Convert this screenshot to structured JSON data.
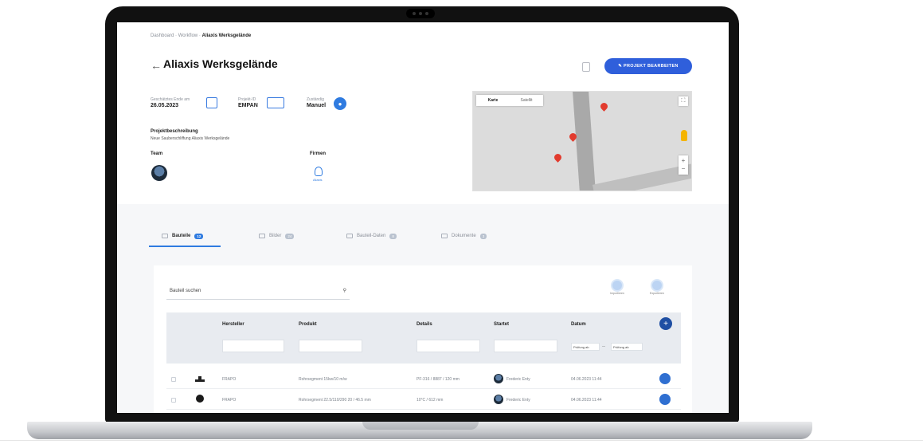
{
  "breadcrumb": {
    "item1": "Dashboard",
    "item2": "Workflow",
    "current": "Aliaxis Werksgelände"
  },
  "header": {
    "back_icon": "back-arrow-icon",
    "title": "Aliaxis Werksgelände",
    "edit_label": "✎ PROJEKT BEARBEITEN"
  },
  "meta": {
    "date_label": "Geschätztes Ende am",
    "date_value": "26.05.2023",
    "code_label": "Projekt-ID",
    "code_value": "EMPAN",
    "status_label": "Zuständig",
    "status_value": "Manuel"
  },
  "description": {
    "heading": "Projektbeschreibung",
    "text": "Neue Sauberschliffung Aliaxis Werksgelände"
  },
  "team": {
    "heading": "Team"
  },
  "firms": {
    "heading": "Firmen",
    "item_label": "Aliaxis"
  },
  "map": {
    "tab_map": "Karte",
    "tab_satellite": "Satellit",
    "pin_count": 3
  },
  "tabs": [
    {
      "label": "Bauteile",
      "count": "12",
      "active": true
    },
    {
      "label": "Bilder",
      "count": "24",
      "active": false
    },
    {
      "label": "Bauteil-Daten",
      "count": "8",
      "active": false
    },
    {
      "label": "Dokumente",
      "count": "3",
      "active": false
    }
  ],
  "table": {
    "search_placeholder": "Bauteil suchen",
    "action1_label": "Importieren",
    "action2_label": "Exportieren",
    "columns": [
      "Hersteller",
      "Produkt",
      "Details",
      "Startet",
      "Datum"
    ],
    "date_from": "Prüfung ab",
    "date_to": "Prüfung ab",
    "rows": [
      {
        "manufacturer": "FRAPO",
        "product": "Rohrsegment 15kw/10 m/w",
        "details": "PF-316 / 8887 / 120 mm",
        "user": "Frederic Enty",
        "date": "04.06.2023 11:44"
      },
      {
        "manufacturer": "FRAPO",
        "product": "Rohrsegment 22.5/110/290 20 / 46.5 mm",
        "details": "10°C / 612 mm",
        "user": "Frederic Enty",
        "date": "04.06.2023 11:44"
      }
    ]
  }
}
